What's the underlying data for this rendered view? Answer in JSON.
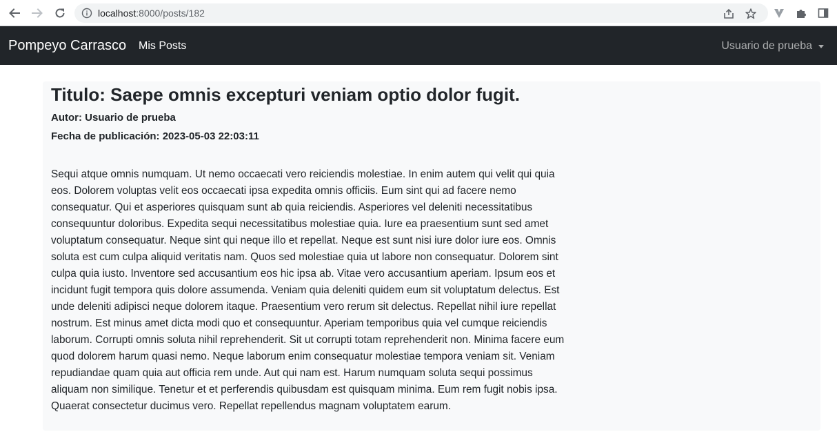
{
  "browser": {
    "url_host": "localhost",
    "url_rest": ":8000/posts/182",
    "icons": {
      "back": "back-arrow-icon",
      "forward": "forward-arrow-icon",
      "reload": "reload-icon",
      "site_info": "info-icon",
      "share": "share-icon",
      "bookmark": "star-icon",
      "extension_v": "v-extension-icon",
      "extensions": "puzzle-icon",
      "side_panel": "side-panel-icon"
    }
  },
  "navbar": {
    "brand": "Pompeyo Carrasco",
    "links": [
      "Mis Posts"
    ],
    "user_menu": "Usuario de prueba",
    "background": "#212529"
  },
  "post": {
    "title": "Titulo: Saepe omnis excepturi veniam optio dolor fugit.",
    "author": "Autor: Usuario de prueba",
    "date": "Fecha de publicación: 2023-05-03 22:03:11",
    "body": "Sequi atque omnis numquam. Ut nemo occaecati vero reiciendis molestiae. In enim autem qui velit qui quia eos. Dolorem voluptas velit eos occaecati ipsa expedita omnis officiis. Eum sint qui ad facere nemo consequatur. Qui et asperiores quisquam sunt ab quia reiciendis. Asperiores vel deleniti necessitatibus consequuntur doloribus. Expedita sequi necessitatibus molestiae quia. Iure ea praesentium sunt sed amet voluptatum consequatur. Neque sint qui neque illo et repellat. Neque est sunt nisi iure dolor iure eos. Omnis soluta est cum culpa aliquid veritatis nam. Quos sed molestiae quia ut labore non consequatur. Dolorem sint culpa quia iusto. Inventore sed accusantium eos hic ipsa ab. Vitae vero accusantium aperiam. Ipsum eos et incidunt fugit tempora quis dolore assumenda. Veniam quia deleniti quidem eum sit voluptatum delectus. Est unde deleniti adipisci neque dolorem itaque. Praesentium vero rerum sit delectus. Repellat nihil iure repellat nostrum. Est minus amet dicta modi quo et consequuntur. Aperiam temporibus quia vel cumque reiciendis laborum. Corrupti omnis soluta nihil reprehenderit. Sit ut corrupti totam reprehenderit non. Minima facere eum quod dolorem harum quasi nemo. Neque laborum enim consequatur molestiae tempora veniam sit. Veniam repudiandae quam quia aut officia rem unde. Aut qui nam est. Harum numquam soluta sequi possimus aliquam non similique. Tenetur et et perferendis quibusdam est quisquam minima. Eum rem fugit nobis ipsa. Quaerat consectetur ducimus vero. Repellat repellendus magnam voluptatem earum."
  }
}
